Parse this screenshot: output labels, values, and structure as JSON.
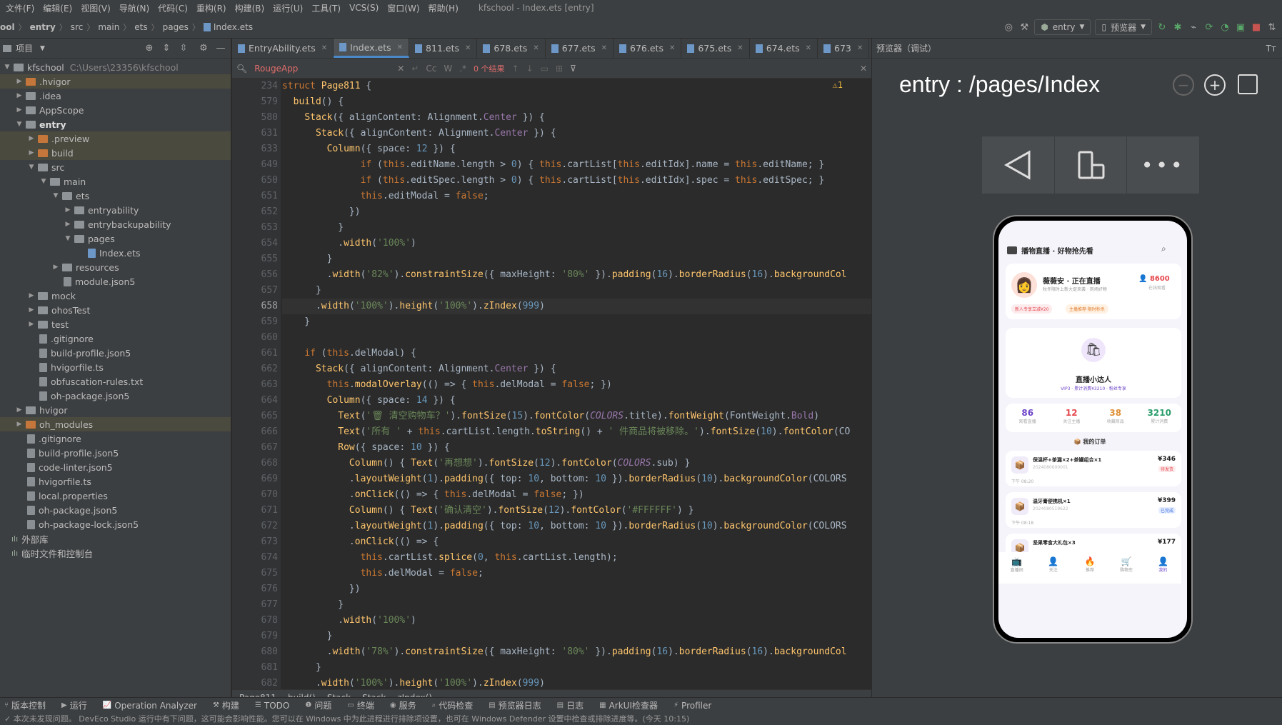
{
  "menubar": {
    "items": [
      "文件(F)",
      "编辑(E)",
      "视图(V)",
      "导航(N)",
      "代码(C)",
      "重构(R)",
      "构建(B)",
      "运行(U)",
      "工具(T)",
      "VCS(S)",
      "窗口(W)",
      "帮助(H)"
    ],
    "window_title": "kfschool - Index.ets [entry]"
  },
  "navbar": {
    "crumbs": [
      "ool",
      "entry",
      "src",
      "main",
      "ets",
      "pages",
      "Index.ets"
    ],
    "run_config": "entry",
    "device": "预览器"
  },
  "sidebar": {
    "title": "项目",
    "tree": [
      {
        "label": "kfschool",
        "extra": "C:\\Users\\23356\\kfschool",
        "indent": 0,
        "open": true,
        "type": "folder"
      },
      {
        "label": ".hvigor",
        "indent": 1,
        "type": "folder-org",
        "hl": true
      },
      {
        "label": ".idea",
        "indent": 1,
        "type": "folder"
      },
      {
        "label": "AppScope",
        "indent": 1,
        "type": "folder"
      },
      {
        "label": "entry",
        "indent": 1,
        "open": true,
        "type": "folder",
        "bold": true
      },
      {
        "label": ".preview",
        "indent": 2,
        "type": "folder-org",
        "hl": true
      },
      {
        "label": "build",
        "indent": 2,
        "type": "folder-org",
        "hl": true
      },
      {
        "label": "src",
        "indent": 2,
        "open": true,
        "type": "folder"
      },
      {
        "label": "main",
        "indent": 3,
        "open": true,
        "type": "folder"
      },
      {
        "label": "ets",
        "indent": 4,
        "open": true,
        "type": "folder"
      },
      {
        "label": "entryability",
        "indent": 5,
        "type": "folder"
      },
      {
        "label": "entrybackupability",
        "indent": 5,
        "type": "folder"
      },
      {
        "label": "pages",
        "indent": 5,
        "open": true,
        "type": "folder"
      },
      {
        "label": "Index.ets",
        "indent": 6,
        "type": "file-ets",
        "noarrow": true
      },
      {
        "label": "resources",
        "indent": 4,
        "type": "folder"
      },
      {
        "label": "module.json5",
        "indent": 4,
        "type": "file",
        "noarrow": true
      },
      {
        "label": "mock",
        "indent": 2,
        "type": "folder"
      },
      {
        "label": "ohosTest",
        "indent": 2,
        "type": "folder"
      },
      {
        "label": "test",
        "indent": 2,
        "type": "folder"
      },
      {
        "label": ".gitignore",
        "indent": 2,
        "type": "file",
        "noarrow": true
      },
      {
        "label": "build-profile.json5",
        "indent": 2,
        "type": "file",
        "noarrow": true
      },
      {
        "label": "hvigorfile.ts",
        "indent": 2,
        "type": "file",
        "noarrow": true
      },
      {
        "label": "obfuscation-rules.txt",
        "indent": 2,
        "type": "file",
        "noarrow": true
      },
      {
        "label": "oh-package.json5",
        "indent": 2,
        "type": "file",
        "noarrow": true
      },
      {
        "label": "hvigor",
        "indent": 1,
        "type": "folder"
      },
      {
        "label": "oh_modules",
        "indent": 1,
        "type": "folder-org",
        "hl": true
      },
      {
        "label": ".gitignore",
        "indent": 1,
        "type": "file",
        "noarrow": true
      },
      {
        "label": "build-profile.json5",
        "indent": 1,
        "type": "file",
        "noarrow": true
      },
      {
        "label": "code-linter.json5",
        "indent": 1,
        "type": "file",
        "noarrow": true
      },
      {
        "label": "hvigorfile.ts",
        "indent": 1,
        "type": "file",
        "noarrow": true
      },
      {
        "label": "local.properties",
        "indent": 1,
        "type": "file",
        "noarrow": true
      },
      {
        "label": "oh-package.json5",
        "indent": 1,
        "type": "file",
        "noarrow": true
      },
      {
        "label": "oh-package-lock.json5",
        "indent": 1,
        "type": "file",
        "noarrow": true
      },
      {
        "label": "外部库",
        "indent": 0,
        "type": "lib",
        "noarrow": true
      },
      {
        "label": "临时文件和控制台",
        "indent": 0,
        "type": "lib",
        "noarrow": true
      }
    ]
  },
  "tabs": [
    {
      "label": "EntryAbility.ets"
    },
    {
      "label": "Index.ets",
      "active": true
    },
    {
      "label": "811.ets"
    },
    {
      "label": "678.ets"
    },
    {
      "label": "677.ets"
    },
    {
      "label": "676.ets"
    },
    {
      "label": "675.ets"
    },
    {
      "label": "674.ets"
    },
    {
      "label": "673"
    }
  ],
  "find": {
    "query": "RougeApp",
    "result": "0 个结果",
    "warn": "⚠1"
  },
  "code": [
    {
      "n": "234",
      "h": "<span class='kw'>struct</span> <span class='fn'>Page811</span> {"
    },
    {
      "n": "579",
      "h": "  <span class='mt'>build</span>() {"
    },
    {
      "n": "580",
      "h": "    <span class='mt'>Stack</span>({ alignContent: Alignment.<span class='pr'>Center</span> }) {"
    },
    {
      "n": "631",
      "h": "      <span class='mt'>Stack</span>({ alignContent: Alignment.<span class='pr'>Center</span> }) {"
    },
    {
      "n": "633",
      "h": "        <span class='mt'>Column</span>({ space: <span class='nu'>12</span> }) {"
    },
    {
      "n": "649",
      "h": "              <span class='kw'>if</span> (<span class='kw'>this</span>.editName.length > <span class='nu'>0</span>) { <span class='kw'>this</span>.cartList[<span class='kw'>this</span>.editIdx].name = <span class='kw'>this</span>.editName; }"
    },
    {
      "n": "650",
      "h": "              <span class='kw'>if</span> (<span class='kw'>this</span>.editSpec.length > <span class='nu'>0</span>) { <span class='kw'>this</span>.cartList[<span class='kw'>this</span>.editIdx].spec = <span class='kw'>this</span>.editSpec; }"
    },
    {
      "n": "651",
      "h": "              <span class='kw'>this</span>.editModal = <span class='kw'>false</span>;"
    },
    {
      "n": "652",
      "h": "            })"
    },
    {
      "n": "653",
      "h": "          }"
    },
    {
      "n": "654",
      "h": "          .<span class='mt'>width</span>(<span class='st'>'100%'</span>)"
    },
    {
      "n": "655",
      "h": "        }"
    },
    {
      "n": "656",
      "h": "        .<span class='mt'>width</span>(<span class='st'>'82%'</span>).<span class='mt'>constraintSize</span>({ maxHeight: <span class='st'>'80%'</span> }).<span class='mt'>padding</span>(<span class='nu'>16</span>).<span class='mt'>borderRadius</span>(<span class='nu'>16</span>).<span class='mt'>backgroundCol</span>"
    },
    {
      "n": "657",
      "h": "      }"
    },
    {
      "n": "658",
      "h": "      .<span class='mt'>width</span>(<span class='st'>'100%'</span>).<span class='mt'>height</span>(<span class='st'>'100%'</span>).<span class='mt'>zIndex</span>(<span class='nu'>999</span>)",
      "cur": true
    },
    {
      "n": "659",
      "h": "    }"
    },
    {
      "n": "660",
      "h": ""
    },
    {
      "n": "661",
      "h": "    <span class='kw'>if</span> (<span class='kw'>this</span>.delModal) {"
    },
    {
      "n": "662",
      "h": "      <span class='mt'>Stack</span>({ alignContent: Alignment.<span class='pr'>Center</span> }) {"
    },
    {
      "n": "663",
      "h": "        <span class='kw'>this</span>.<span class='mt'>modalOverlay</span>(() => { <span class='kw'>this</span>.delModal = <span class='kw'>false</span>; })"
    },
    {
      "n": "664",
      "h": "        <span class='mt'>Column</span>({ space: <span class='nu'>14</span> }) {"
    },
    {
      "n": "665",
      "h": "          <span class='mt'>Text</span>(<span class='st'>'🗑 清空购物车？'</span>).<span class='mt'>fontSize</span>(<span class='nu'>15</span>).<span class='mt'>fontColor</span>(<span class='cn'>COLORS</span>.title).<span class='mt'>fontWeight</span>(FontWeight.<span class='pr'>Bold</span>)"
    },
    {
      "n": "666",
      "h": "          <span class='mt'>Text</span>(<span class='st'>'所有 '</span> + <span class='kw'>this</span>.cartList.length.<span class='mt'>toString</span>() + <span class='st'>' 件商品将被移除。'</span>).<span class='mt'>fontSize</span>(<span class='nu'>10</span>).<span class='mt'>fontColor</span>(CO"
    },
    {
      "n": "667",
      "h": "          <span class='mt'>Row</span>({ space: <span class='nu'>10</span> }) {"
    },
    {
      "n": "668",
      "h": "            <span class='mt'>Column</span>() { <span class='mt'>Text</span>(<span class='st'>'再想想'</span>).<span class='mt'>fontSize</span>(<span class='nu'>12</span>).<span class='mt'>fontColor</span>(<span class='cn'>COLORS</span>.sub) }"
    },
    {
      "n": "669",
      "h": "            .<span class='mt'>layoutWeight</span>(<span class='nu'>1</span>).<span class='mt'>padding</span>({ top: <span class='nu'>10</span>, bottom: <span class='nu'>10</span> }).<span class='mt'>borderRadius</span>(<span class='nu'>10</span>).<span class='mt'>backgroundColor</span>(COLORS"
    },
    {
      "n": "670",
      "h": "            .<span class='mt'>onClick</span>(() => { <span class='kw'>this</span>.delModal = <span class='kw'>false</span>; })"
    },
    {
      "n": "671",
      "h": "            <span class='mt'>Column</span>() { <span class='mt'>Text</span>(<span class='st'>'确认清空'</span>).<span class='mt'>fontSize</span>(<span class='nu'>12</span>).<span class='mt'>fontColor</span>(<span class='st'>'#FFFFFF'</span>) }"
    },
    {
      "n": "672",
      "h": "            .<span class='mt'>layoutWeight</span>(<span class='nu'>1</span>).<span class='mt'>padding</span>({ top: <span class='nu'>10</span>, bottom: <span class='nu'>10</span> }).<span class='mt'>borderRadius</span>(<span class='nu'>10</span>).<span class='mt'>backgroundColor</span>(COLORS"
    },
    {
      "n": "673",
      "h": "            .<span class='mt'>onClick</span>(() => {"
    },
    {
      "n": "674",
      "h": "              <span class='kw'>this</span>.cartList.<span class='mt'>splice</span>(<span class='nu'>0</span>, <span class='kw'>this</span>.cartList.length);"
    },
    {
      "n": "675",
      "h": "              <span class='kw'>this</span>.delModal = <span class='kw'>false</span>;"
    },
    {
      "n": "676",
      "h": "            })"
    },
    {
      "n": "677",
      "h": "          }"
    },
    {
      "n": "678",
      "h": "          .<span class='mt'>width</span>(<span class='st'>'100%'</span>)"
    },
    {
      "n": "679",
      "h": "        }"
    },
    {
      "n": "680",
      "h": "        .<span class='mt'>width</span>(<span class='st'>'78%'</span>).<span class='mt'>constraintSize</span>({ maxHeight: <span class='st'>'80%'</span> }).<span class='mt'>padding</span>(<span class='nu'>16</span>).<span class='mt'>borderRadius</span>(<span class='nu'>16</span>).<span class='mt'>backgroundCol</span>"
    },
    {
      "n": "681",
      "h": "      }"
    },
    {
      "n": "682",
      "h": "      .<span class='mt'>width</span>(<span class='st'>'100%'</span>).<span class='mt'>height</span>(<span class='st'>'100%'</span>).<span class='mt'>zIndex</span>(<span class='nu'>999</span>)"
    }
  ],
  "code_breadcrumb": [
    "Page811",
    "build()",
    "Stack",
    "Stack",
    "zIndex()"
  ],
  "preview": {
    "title": "预览器（调试）",
    "route": "entry : /pages/Index",
    "app": {
      "header": "播物直播 · 好物抢先看",
      "live_name": "薇薇安 · 正在直播",
      "live_sub": "秋冬限时上新大促来袭 · 到场好物",
      "live_viewers": "8600",
      "live_viewers_label": "在线观看",
      "live_tag1": "新人专享立减¥20",
      "live_tag2": "主播推荐·限时秒杀",
      "profile_name": "直播小达人",
      "profile_sub": "VIP3 · 累计消费¥3210 · 粉丝专享",
      "stats": [
        {
          "v": "86",
          "l": "观看直播"
        },
        {
          "v": "12",
          "l": "关注主播"
        },
        {
          "v": "38",
          "l": "收藏商品"
        },
        {
          "v": "3210",
          "l": "累计消费"
        }
      ],
      "orders_title": "📦 我的订单",
      "orders": [
        {
          "name": "保温杯+茶漏×2+茶罐组合×1",
          "price": "¥346",
          "status": "待发货",
          "no": "2024080600001",
          "time": "下午 08:20"
        },
        {
          "name": "温牙膏便携机×1",
          "price": "¥399",
          "status": "已完成",
          "no": "2024080519622",
          "time": "下午 08:18"
        },
        {
          "name": "坚果零食大礼包×3",
          "price": "¥177"
        }
      ],
      "tabs": [
        "直播间",
        "关注",
        "推荐",
        "购物车",
        "我的"
      ]
    }
  },
  "bottom_tools": [
    "版本控制",
    "运行",
    "TODO",
    "问题",
    "终端",
    "服务",
    "代码检查",
    "预览器日志",
    "日志",
    "ArkUI检查器",
    "Profiler"
  ],
  "operation_analyzer": "Operation Analyzer",
  "build_label": "构建",
  "footer": "✓ 本次未发现问题。 DevEco Studio 运行中有下问题，这可能会影响性能。您可以在 Windows 中为此进程进行排除项设置，也可在 Windows Defender 设置中检查或排除进度等。(今天 10:15)",
  "colors": {
    "accent": "#4a88c7",
    "live_red": "#e5484d",
    "brand_purple": "#6f46c9"
  }
}
